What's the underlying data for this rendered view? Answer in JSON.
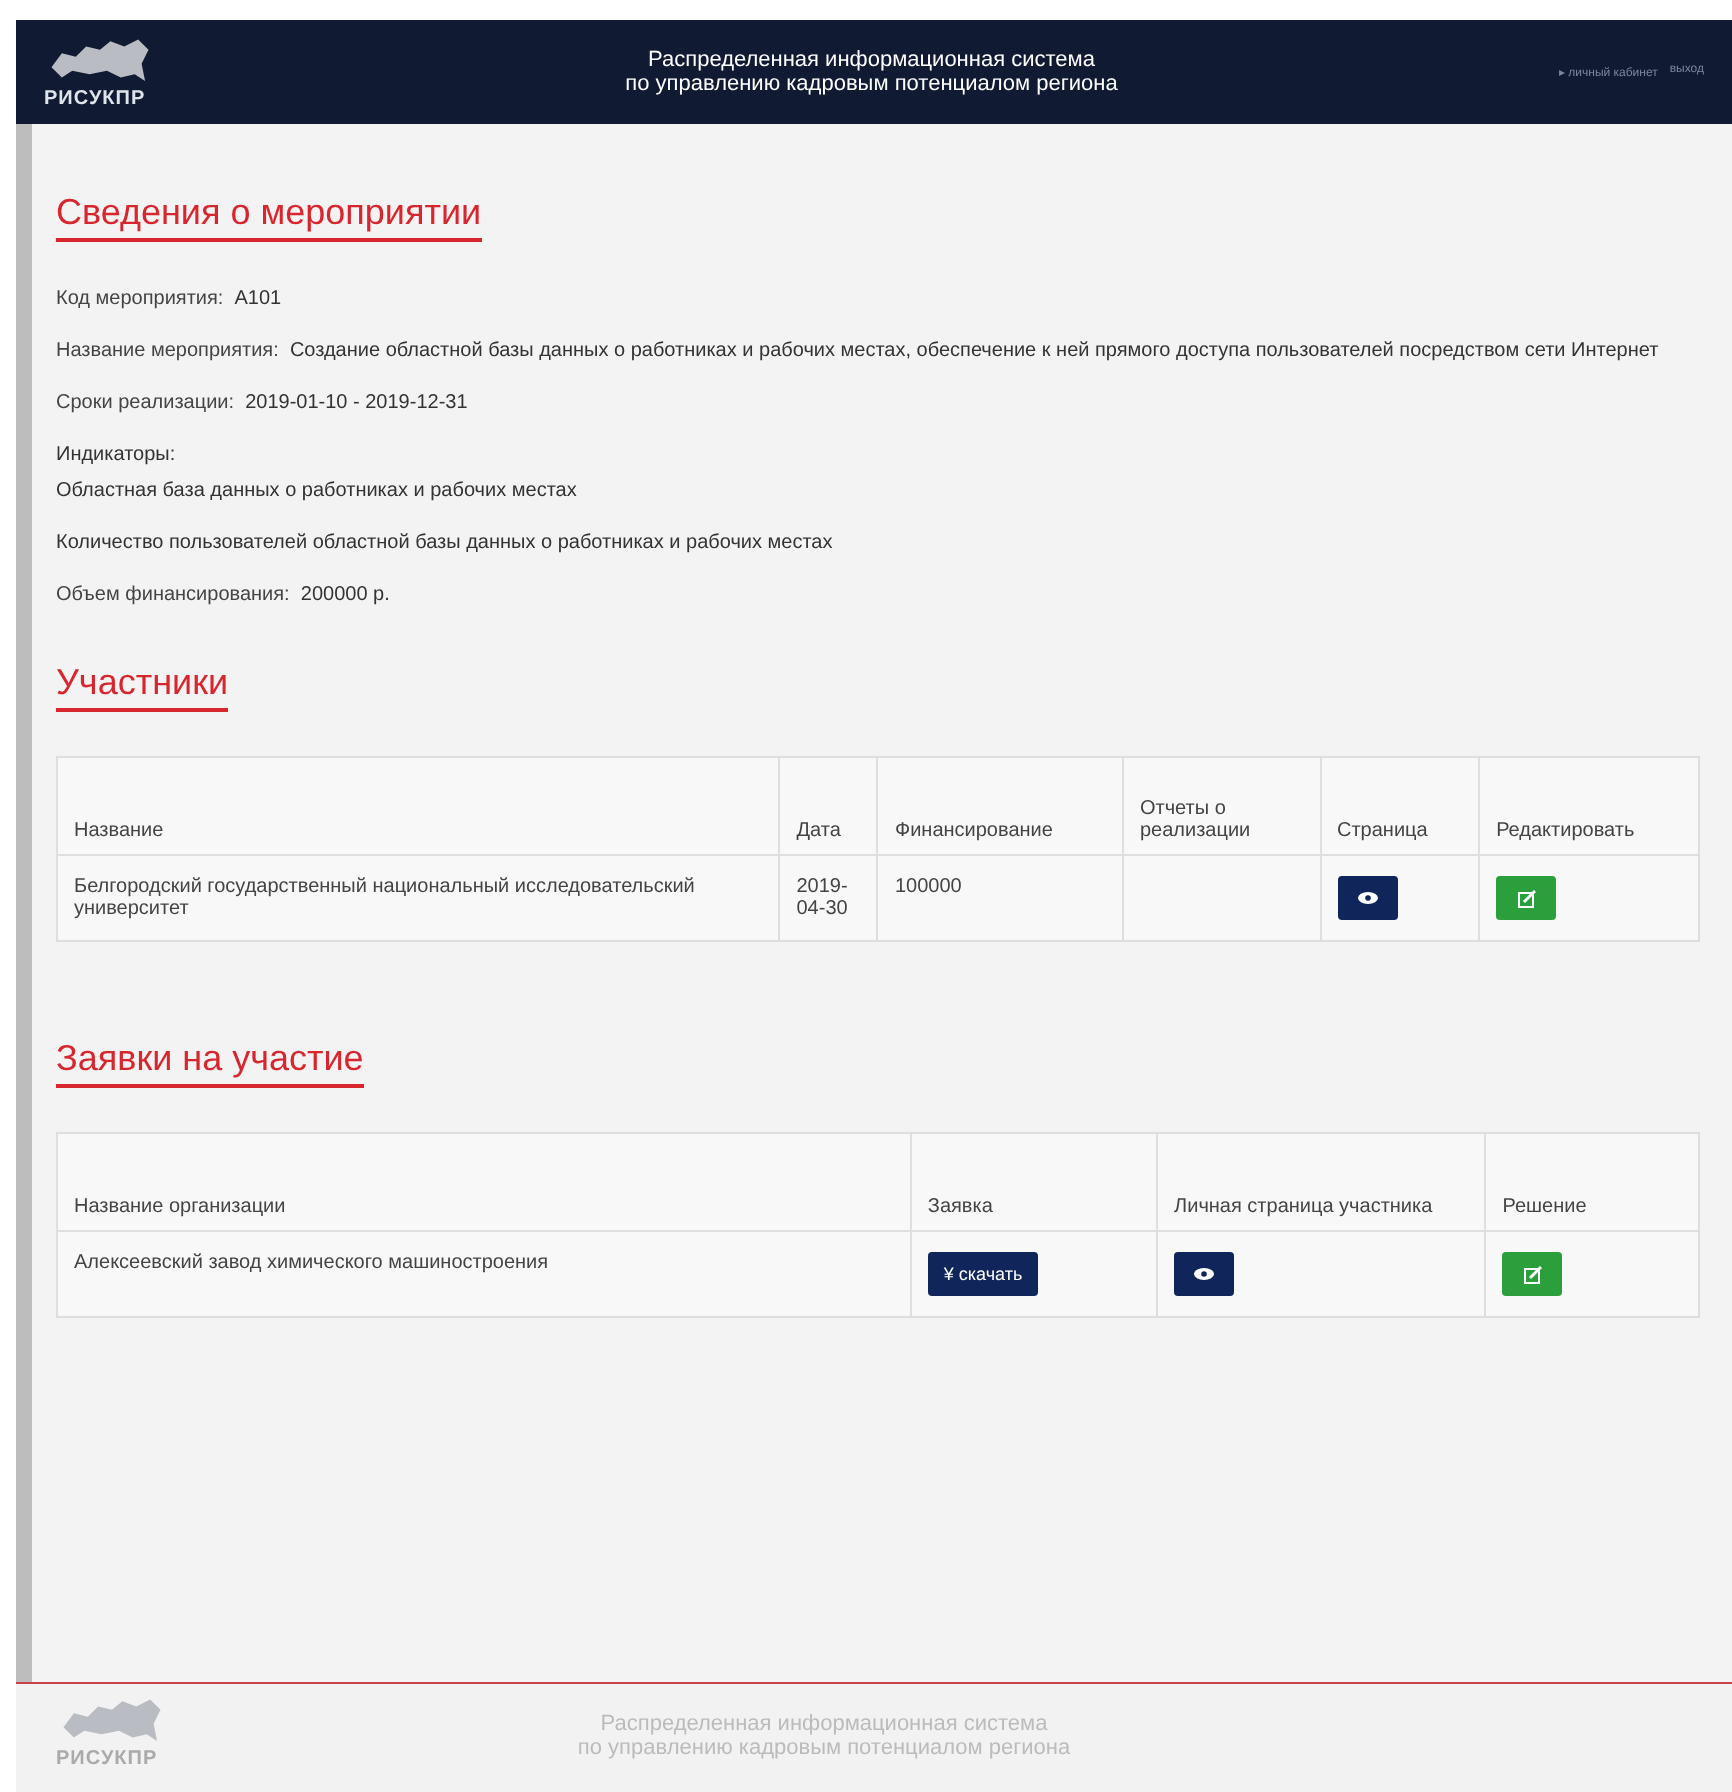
{
  "header": {
    "logo_text": "РИСУКПР",
    "title_lines": [
      "Распределенная информационная система",
      "по управлению кадровым потенциалом региона"
    ],
    "links": [
      "▸ личный кабинет",
      "выход"
    ]
  },
  "event": {
    "heading": "Сведения о мероприятии",
    "fields": [
      {
        "label": "Код мероприятия:",
        "value": "A101"
      },
      {
        "label": "Название мероприятия:",
        "value": "Создание областной базы данных о работниках и рабочих местах, обеспечение к ней прямого доступа пользователей посредством сети Интернет"
      },
      {
        "label": "Сроки реализации:",
        "value": "2019-01-10 - 2019-12-31"
      }
    ],
    "indicators_label": "Индикаторы:",
    "indicators": [
      "Областная база данных о работниках и рабочих местах",
      "Количество пользователей областной базы данных о работниках и рабочих местах"
    ],
    "funding": {
      "label": "Объем финансирования:",
      "value": "200000 р."
    }
  },
  "participants": {
    "heading": "Участники",
    "columns": [
      "Название",
      "Дата",
      "Финансирование",
      "Отчеты о реализации",
      "Страница",
      "Редактировать"
    ],
    "rows": [
      {
        "name": "Белгородский государственный национальный исследовательский университет",
        "date": "2019-04-30",
        "funding": "100000"
      }
    ]
  },
  "applications": {
    "heading": "Заявки на участие",
    "columns": [
      "Название организации",
      "Заявка",
      "Личная страница участника",
      "Решение"
    ],
    "rows": [
      {
        "name": "Алексеевский завод химического машиностроения",
        "download": "¥ скачать"
      }
    ]
  },
  "footer": {
    "logo_text": "РИСУКПР",
    "title_lines": [
      "Распределенная информационная система",
      "по управлению кадровым потенциалом региона"
    ]
  }
}
